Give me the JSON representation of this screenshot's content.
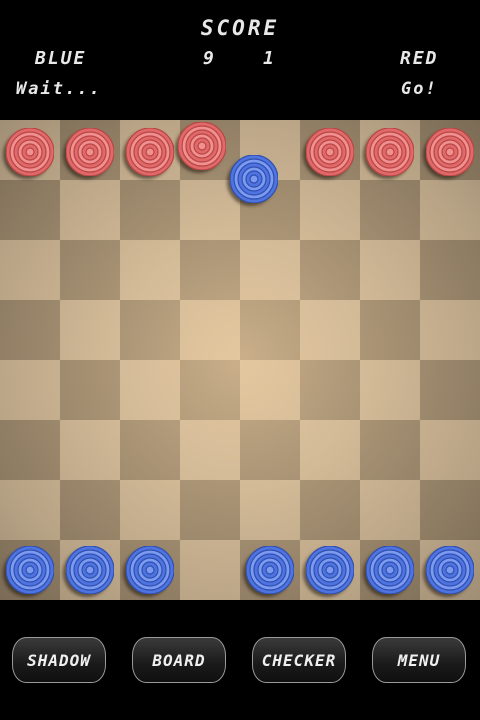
{
  "header": {
    "title": "SCORE",
    "blue_label": "BLUE",
    "red_label": "RED",
    "blue_score": "9",
    "red_score": "1",
    "blue_status": "Wait...",
    "red_status": "Go!"
  },
  "colors": {
    "light_square": "#cdb695",
    "dark_square": "#9e8a6e",
    "red_checker": "#e06a6a",
    "blue_checker": "#4f74e0"
  },
  "board": {
    "rows": 8,
    "cols": 8,
    "pieces": [
      {
        "color": "red",
        "row": 0,
        "col": 0
      },
      {
        "color": "red",
        "row": 0,
        "col": 1
      },
      {
        "color": "red",
        "row": 0,
        "col": 2
      },
      {
        "color": "red",
        "row": 0,
        "col": 3
      },
      {
        "color": "red",
        "row": 0,
        "col": 5
      },
      {
        "color": "red",
        "row": 0,
        "col": 6
      },
      {
        "color": "red",
        "row": 0,
        "col": 7
      },
      {
        "color": "blue",
        "row": 1,
        "col": 4
      },
      {
        "color": "blue",
        "row": 7,
        "col": 0
      },
      {
        "color": "blue",
        "row": 7,
        "col": 1
      },
      {
        "color": "blue",
        "row": 7,
        "col": 2
      },
      {
        "color": "blue",
        "row": 7,
        "col": 4
      },
      {
        "color": "blue",
        "row": 7,
        "col": 5
      },
      {
        "color": "blue",
        "row": 7,
        "col": 6
      },
      {
        "color": "blue",
        "row": 7,
        "col": 7
      }
    ]
  },
  "buttons": {
    "shadow": "SHADOW",
    "board": "BOARD",
    "checker": "CHECKER",
    "menu": "MENU"
  }
}
